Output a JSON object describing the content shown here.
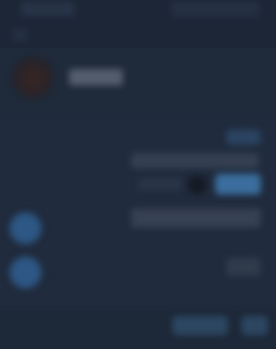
{
  "colors": {
    "background": "#1f2a3a",
    "topbar": "#1c2636",
    "content": "#202b3d",
    "bottombar": "#1d2838",
    "accent_blue": "#3b6e9e",
    "icon_blue": "#2d5784",
    "avatar_dark": "#3a2623"
  },
  "icons": {
    "avatar": "profile-avatar",
    "circle_1": "blue-circle-icon",
    "circle_2": "blue-circle-icon"
  }
}
